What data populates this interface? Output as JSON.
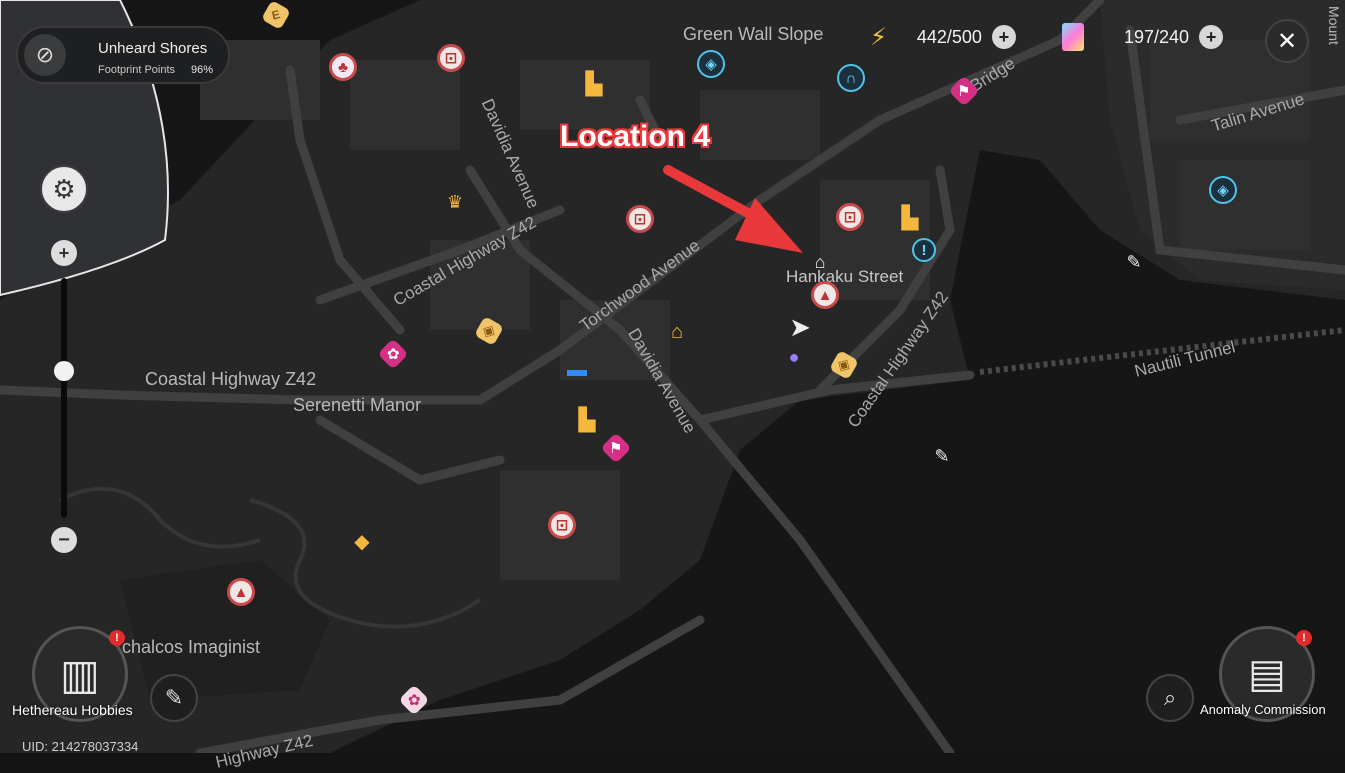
{
  "region_card": {
    "title": "Unheard Shores",
    "subtitle": "Footprint Points",
    "percent": "96%"
  },
  "resources": {
    "battery": "442/500",
    "cards": "197/240"
  },
  "annotation": "Location 4",
  "places": {
    "green_wall_slope": "Green Wall Slope",
    "hankaku_street": "Hankaku Street",
    "coastal_highway_left": "Coastal Highway Z42",
    "serenetti_manor": "Serenetti Manor",
    "chalcos": "chalcos Imaginist",
    "nautili_tunnel": "Nautili Tunnel",
    "talin_avenue": "Talin Avenue",
    "coastal_highway_a": "Coastal Highway Z42",
    "coastal_highway_b": "Coastal Highway Z42",
    "coastal_highway_bottom": "Highway Z42",
    "davidia_avenue_a": "Davidia Avenue",
    "davidia_avenue_b": "Davidia Avenue",
    "torchwood_avenue": "Torchwood Avenue",
    "bridge": "Bridge",
    "edge_text": "Mount"
  },
  "bottom_left": {
    "hethereau_label": "Hethereau Hobbies",
    "uid": "UID: 214278037334"
  },
  "bottom_right": {
    "anomaly_label": "Anomaly Commission"
  },
  "icons": {
    "close": "close-icon",
    "settings": "gear-icon",
    "zoom_in": "plus-icon",
    "zoom_out": "minus-icon"
  },
  "colors": {
    "annotation_red": "#e8383a",
    "map_bg": "#141414",
    "road": "#3b3b3b",
    "alert": "#e02b2b"
  }
}
